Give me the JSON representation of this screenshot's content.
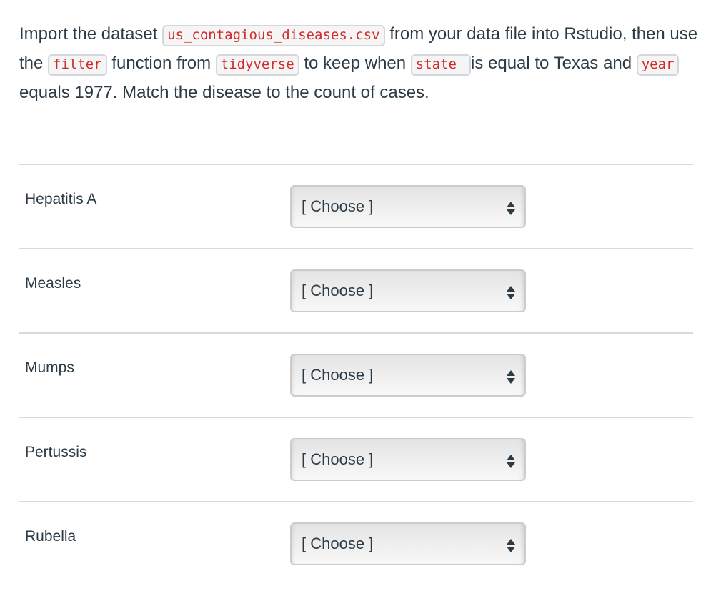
{
  "question": {
    "parts": [
      {
        "type": "text",
        "value": "Import the dataset "
      },
      {
        "type": "code",
        "value": "us_contagious_diseases.csv"
      },
      {
        "type": "text",
        "value": " from your data file into Rstudio, then use the "
      },
      {
        "type": "code",
        "value": "filter"
      },
      {
        "type": "text",
        "value": " function from "
      },
      {
        "type": "code",
        "value": "tidyverse"
      },
      {
        "type": "text",
        "value": " to keep when "
      },
      {
        "type": "code",
        "value": "state"
      },
      {
        "type": "text",
        "value": "is equal to Texas and "
      },
      {
        "type": "code",
        "value": "year"
      },
      {
        "type": "text",
        "value": " equals 1977.  Match the disease to the count of cases."
      }
    ]
  },
  "matches": [
    {
      "label": "Hepatitis A",
      "selected": "[ Choose ]"
    },
    {
      "label": "Measles",
      "selected": "[ Choose ]"
    },
    {
      "label": "Mumps",
      "selected": "[ Choose ]"
    },
    {
      "label": "Pertussis",
      "selected": "[ Choose ]"
    },
    {
      "label": "Rubella",
      "selected": "[ Choose ]"
    }
  ],
  "icons": {
    "select_arrows": "up-down-arrows-icon"
  },
  "colors": {
    "code_text": "#d22a2a",
    "body_text": "#2d3b45",
    "divider": "#d9d9d9"
  }
}
